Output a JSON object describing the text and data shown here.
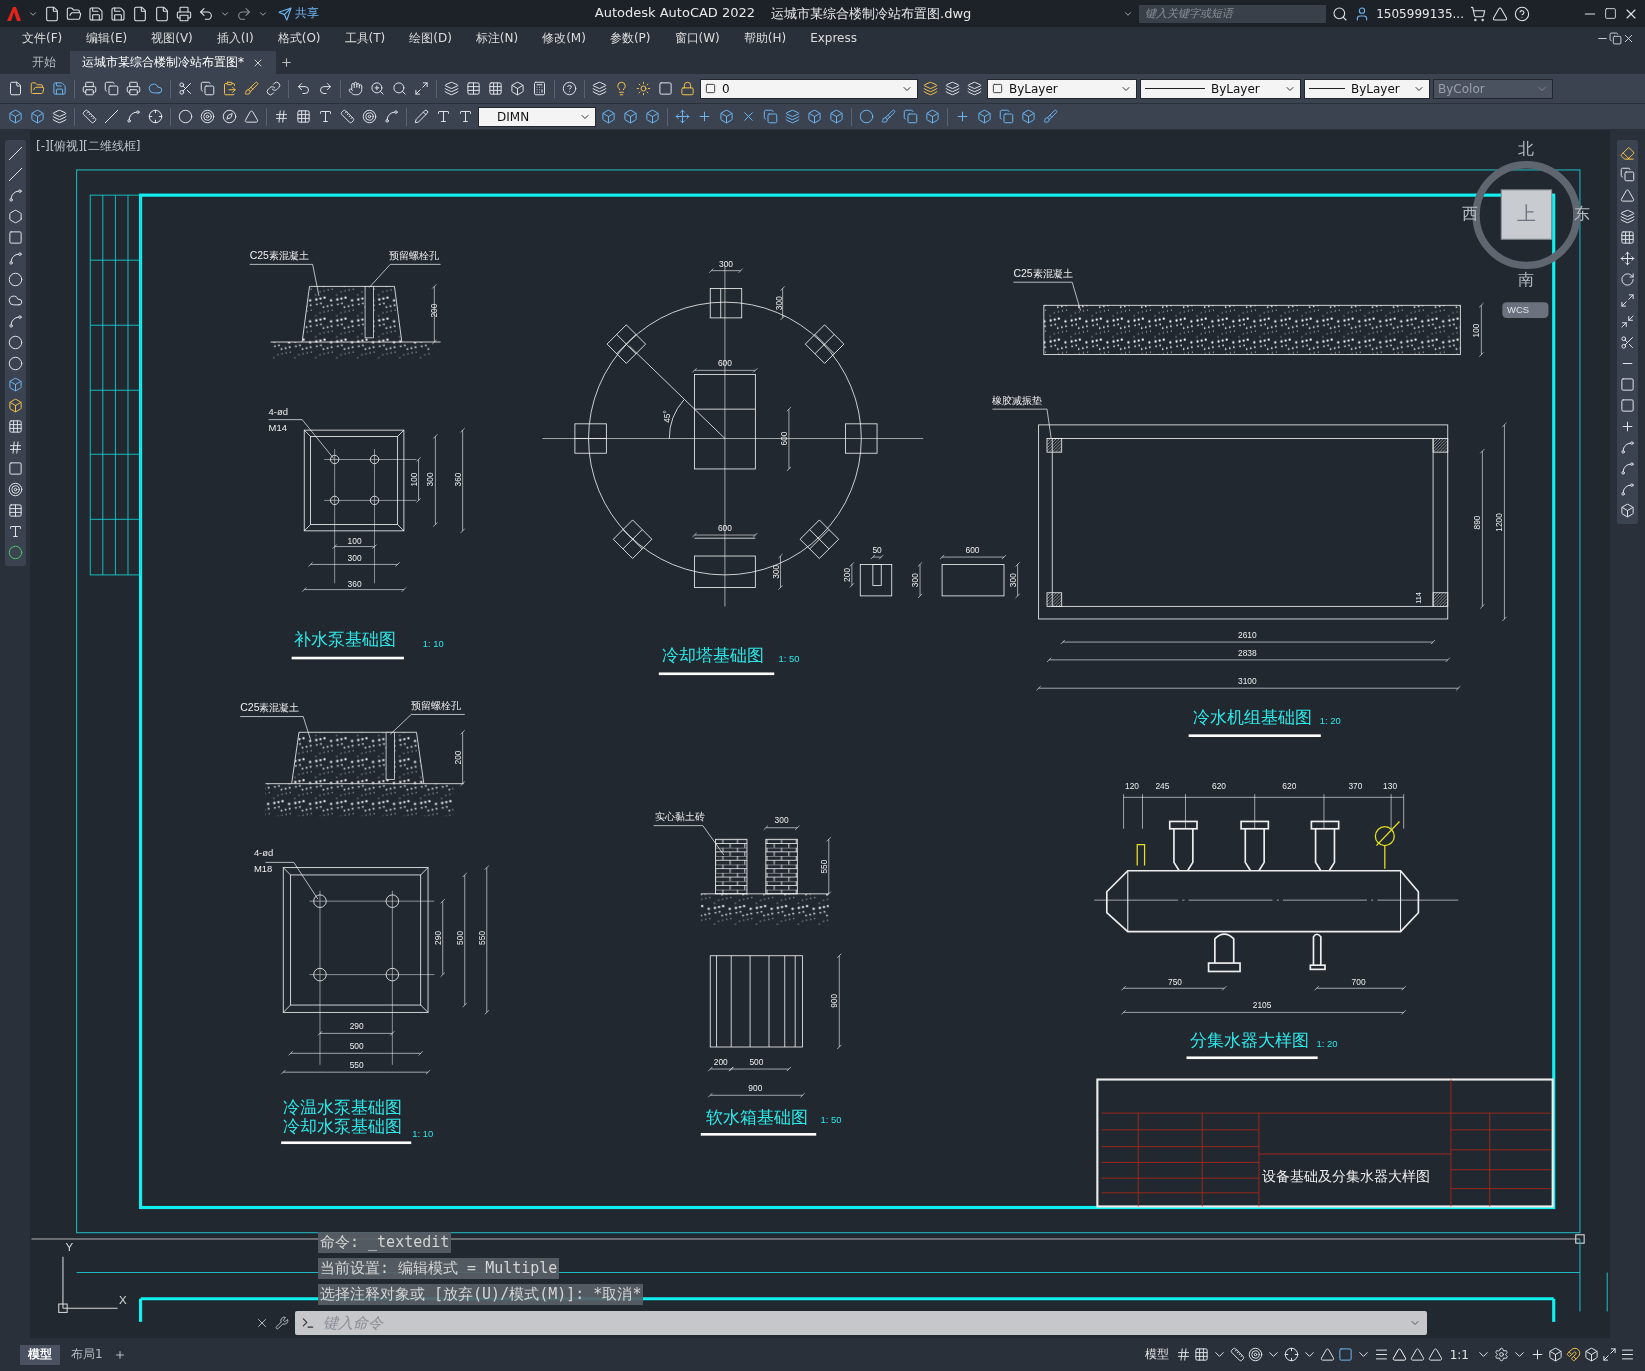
{
  "title_bar": {
    "share": "共享",
    "app": "Autodesk AutoCAD 2022",
    "file": "运城市某综合楼制冷站布置图.dwg",
    "search": {
      "placeholder": "键入关键字或短语"
    },
    "user": "1505999135..."
  },
  "menu": [
    "文件(F)",
    "编辑(E)",
    "视图(V)",
    "插入(I)",
    "格式(O)",
    "工具(T)",
    "绘图(D)",
    "标注(N)",
    "修改(M)",
    "参数(P)",
    "窗口(W)",
    "帮助(H)",
    "Express"
  ],
  "tabs": [
    {
      "label": "开始",
      "selected": false
    },
    {
      "label": "运城市某综合楼制冷站布置图*",
      "selected": true
    }
  ],
  "properties": {
    "layer": "0",
    "color_setting": "ByLayer",
    "linetype": "ByLayer",
    "lineweight": "ByLayer",
    "plot_style": "ByColor",
    "dim_style": "DIMN"
  },
  "viewport_label": "[-][俯视][二维线框]",
  "viewcube": {
    "north": "北",
    "south": "南",
    "west": "西",
    "east": "东",
    "top": "上",
    "ucs": "WCS"
  },
  "drawing": {
    "views": [
      {
        "kind": "pump_small",
        "title_lines": [
          "补水泵基础图"
        ],
        "scale": "1: 10",
        "labels": [
          "C25素混凝土",
          "预留螺栓孔",
          "4-ød",
          "M14"
        ],
        "dims": [
          "200",
          "100",
          "300",
          "360",
          "100",
          "300",
          "360"
        ]
      },
      {
        "kind": "cooling_tower",
        "title_lines": [
          "冷却塔基础图"
        ],
        "scale": "1: 50",
        "labels": [
          "45°"
        ],
        "dims": [
          "300",
          "300",
          "600",
          "600",
          "600",
          "300",
          "50",
          "200",
          "300",
          "600",
          "300"
        ]
      },
      {
        "kind": "chiller",
        "title_lines": [
          "冷水机组基础图"
        ],
        "scale": "1: 20",
        "labels": [
          "C25素混凝土",
          "橡胶减振垫"
        ],
        "dims": [
          "100",
          "890",
          "1200",
          "114",
          "2610",
          "2838",
          "3100"
        ]
      },
      {
        "kind": "pump_large",
        "title_lines": [
          "冷温水泵基础图",
          "冷却水泵基础图"
        ],
        "scale": "1: 10",
        "labels": [
          "C25素混凝土",
          "预留螺栓孔",
          "4-ød",
          "M18"
        ],
        "dims": [
          "200",
          "290",
          "500",
          "550",
          "290",
          "500",
          "550"
        ]
      },
      {
        "kind": "water_tank",
        "title_lines": [
          "软水箱基础图"
        ],
        "scale": "1: 50",
        "labels": [
          "实心黏土砖"
        ],
        "dims": [
          "300",
          "550",
          "900",
          "200",
          "500",
          "900"
        ]
      },
      {
        "kind": "manifold",
        "title_lines": [
          "分集水器大样图"
        ],
        "scale": "1: 20",
        "dims": [
          "120",
          "245",
          "620",
          "620",
          "370",
          "130",
          "750",
          "700",
          "2105"
        ]
      }
    ],
    "title_block": {
      "drawing_name": "设备基础及分集水器大样图"
    },
    "ucs_icon": {
      "x": "X",
      "y": "Y"
    }
  },
  "command_line": {
    "history": [
      "命令: _textedit",
      "当前设置: 编辑模式 = Multiple",
      "选择注释对象或 [放弃(U)/模式(M)]: *取消*"
    ],
    "placeholder": "键入命令"
  },
  "layout_tabs": [
    {
      "label": "模型",
      "selected": true
    },
    {
      "label": "布局1",
      "selected": false
    }
  ],
  "status_bar": {
    "space": "模型",
    "scale": "1:1"
  }
}
